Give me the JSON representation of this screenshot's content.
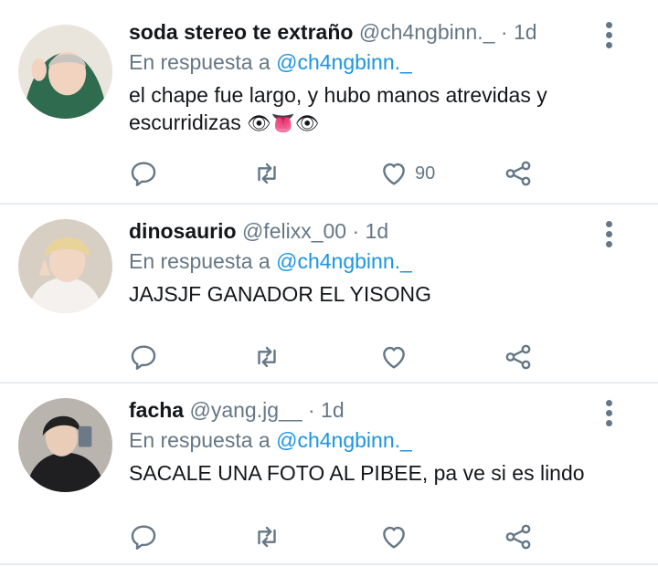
{
  "colors": {
    "name": "#14171a",
    "muted": "#657786",
    "link": "#1b95e0",
    "divider": "#e6ecf0"
  },
  "tweets": [
    {
      "name": "soda stereo te extraño",
      "handle": "@ch4ngbinn._",
      "separator": "·",
      "time": "1d",
      "reply_prefix": "En respuesta a",
      "reply_to": "@ch4ngbinn._",
      "text_line1": "el chape fue largo, y hubo manos atrevidas y",
      "text_line2": "escurridizas",
      "text_emoji": "👁👅👁",
      "like_count": "90",
      "reply_icon": "reply-icon",
      "retweet_icon": "retweet-icon",
      "like_icon": "heart-icon",
      "share_icon": "share-icon"
    },
    {
      "name": "dinosaurio",
      "handle": "@felixx_00",
      "separator": "·",
      "time": "1d",
      "reply_prefix": "En respuesta a",
      "reply_to": "@ch4ngbinn._",
      "text_line1": "JAJSJF GANADOR EL YISONG",
      "like_count": ""
    },
    {
      "name": "facha",
      "handle": "@yang.jg__",
      "separator": "·",
      "time": "1d",
      "reply_prefix": "En respuesta a",
      "reply_to": "@ch4ngbinn._",
      "text_line1": "SACALE UNA FOTO AL PIBEE, pa ve si es lindo",
      "like_count": ""
    }
  ]
}
